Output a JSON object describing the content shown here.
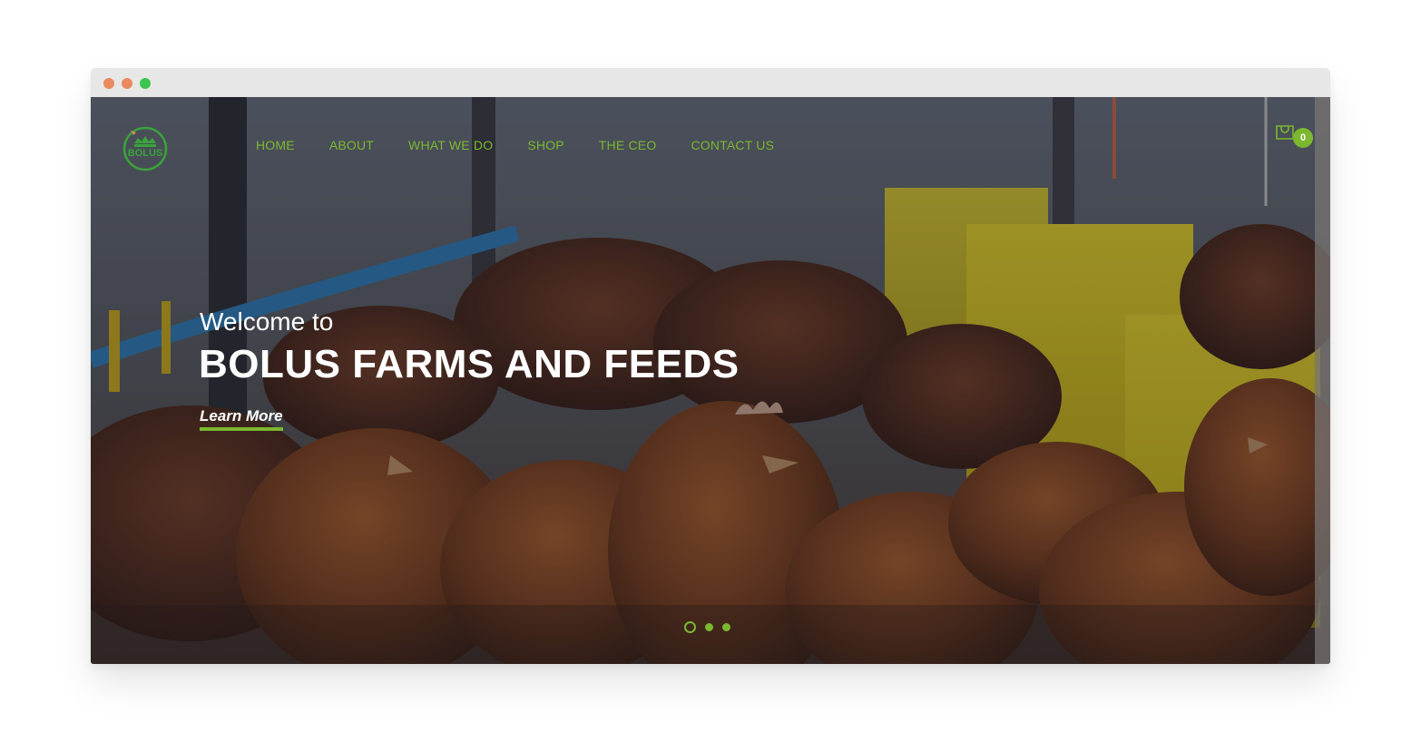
{
  "window": {
    "controls": [
      {
        "name": "close",
        "color": "#e98a5e"
      },
      {
        "name": "minimize",
        "color": "#e98a5e"
      },
      {
        "name": "maximize",
        "color": "#3cc451"
      }
    ]
  },
  "logo": {
    "text": "BOLUS",
    "color": "#3aa33a"
  },
  "nav": {
    "items": [
      {
        "label": "HOME"
      },
      {
        "label": "ABOUT"
      },
      {
        "label": "WHAT WE DO"
      },
      {
        "label": "SHOP"
      },
      {
        "label": "THE CEO"
      },
      {
        "label": "CONTACT US"
      }
    ],
    "color": "#7cb82f"
  },
  "cart": {
    "icon": "shopping-bag-icon",
    "count": "0"
  },
  "hero": {
    "welcome": "Welcome to",
    "title": "BOLUS FARMS AND FEEDS",
    "cta": "Learn More",
    "accent": "#7cb82f"
  },
  "slider": {
    "total": 3,
    "active": 1
  }
}
